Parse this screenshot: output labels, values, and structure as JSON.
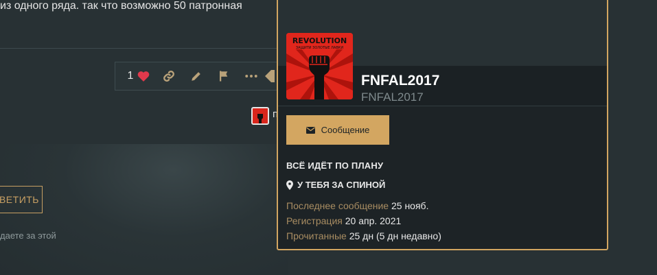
{
  "post": {
    "text": "из одного ряда. так что возможно 50 патронная",
    "likes_count": "1",
    "reply_label": "ВЕТИТЬ",
    "reply_hint": "даете за этой",
    "mini_after": "п"
  },
  "card": {
    "avatar_text_top": "REVOLUTION",
    "avatar_text_sub": "ЗАЩИТИ ЗОЛОТЫЕ ЛАВКИ",
    "username": "FNFAL2017",
    "user_title": "FNFAL2017",
    "message_button": "Сообщение",
    "status": "ВСЁ ИДЁТ ПО ПЛАНУ",
    "location": "У ТЕБЯ ЗА СПИНОЙ",
    "stats": [
      {
        "label": "Последнее сообщение",
        "value": "25 нояб."
      },
      {
        "label": "Регистрация",
        "value": "20 апр. 2021"
      },
      {
        "label": "Прочитанные",
        "value": "25 дн (5 дн недавно)"
      }
    ]
  },
  "colors": {
    "accent": "#d3a661",
    "card_bg": "#1d2326",
    "page_bg": "#283134",
    "heart": "#e0394c",
    "avatar_red": "#e1261c"
  },
  "icons": [
    "heart-icon",
    "link-icon",
    "pencil-icon",
    "flag-icon",
    "more-icon",
    "envelope-icon",
    "map-marker-icon",
    "raised-fist-icon"
  ]
}
